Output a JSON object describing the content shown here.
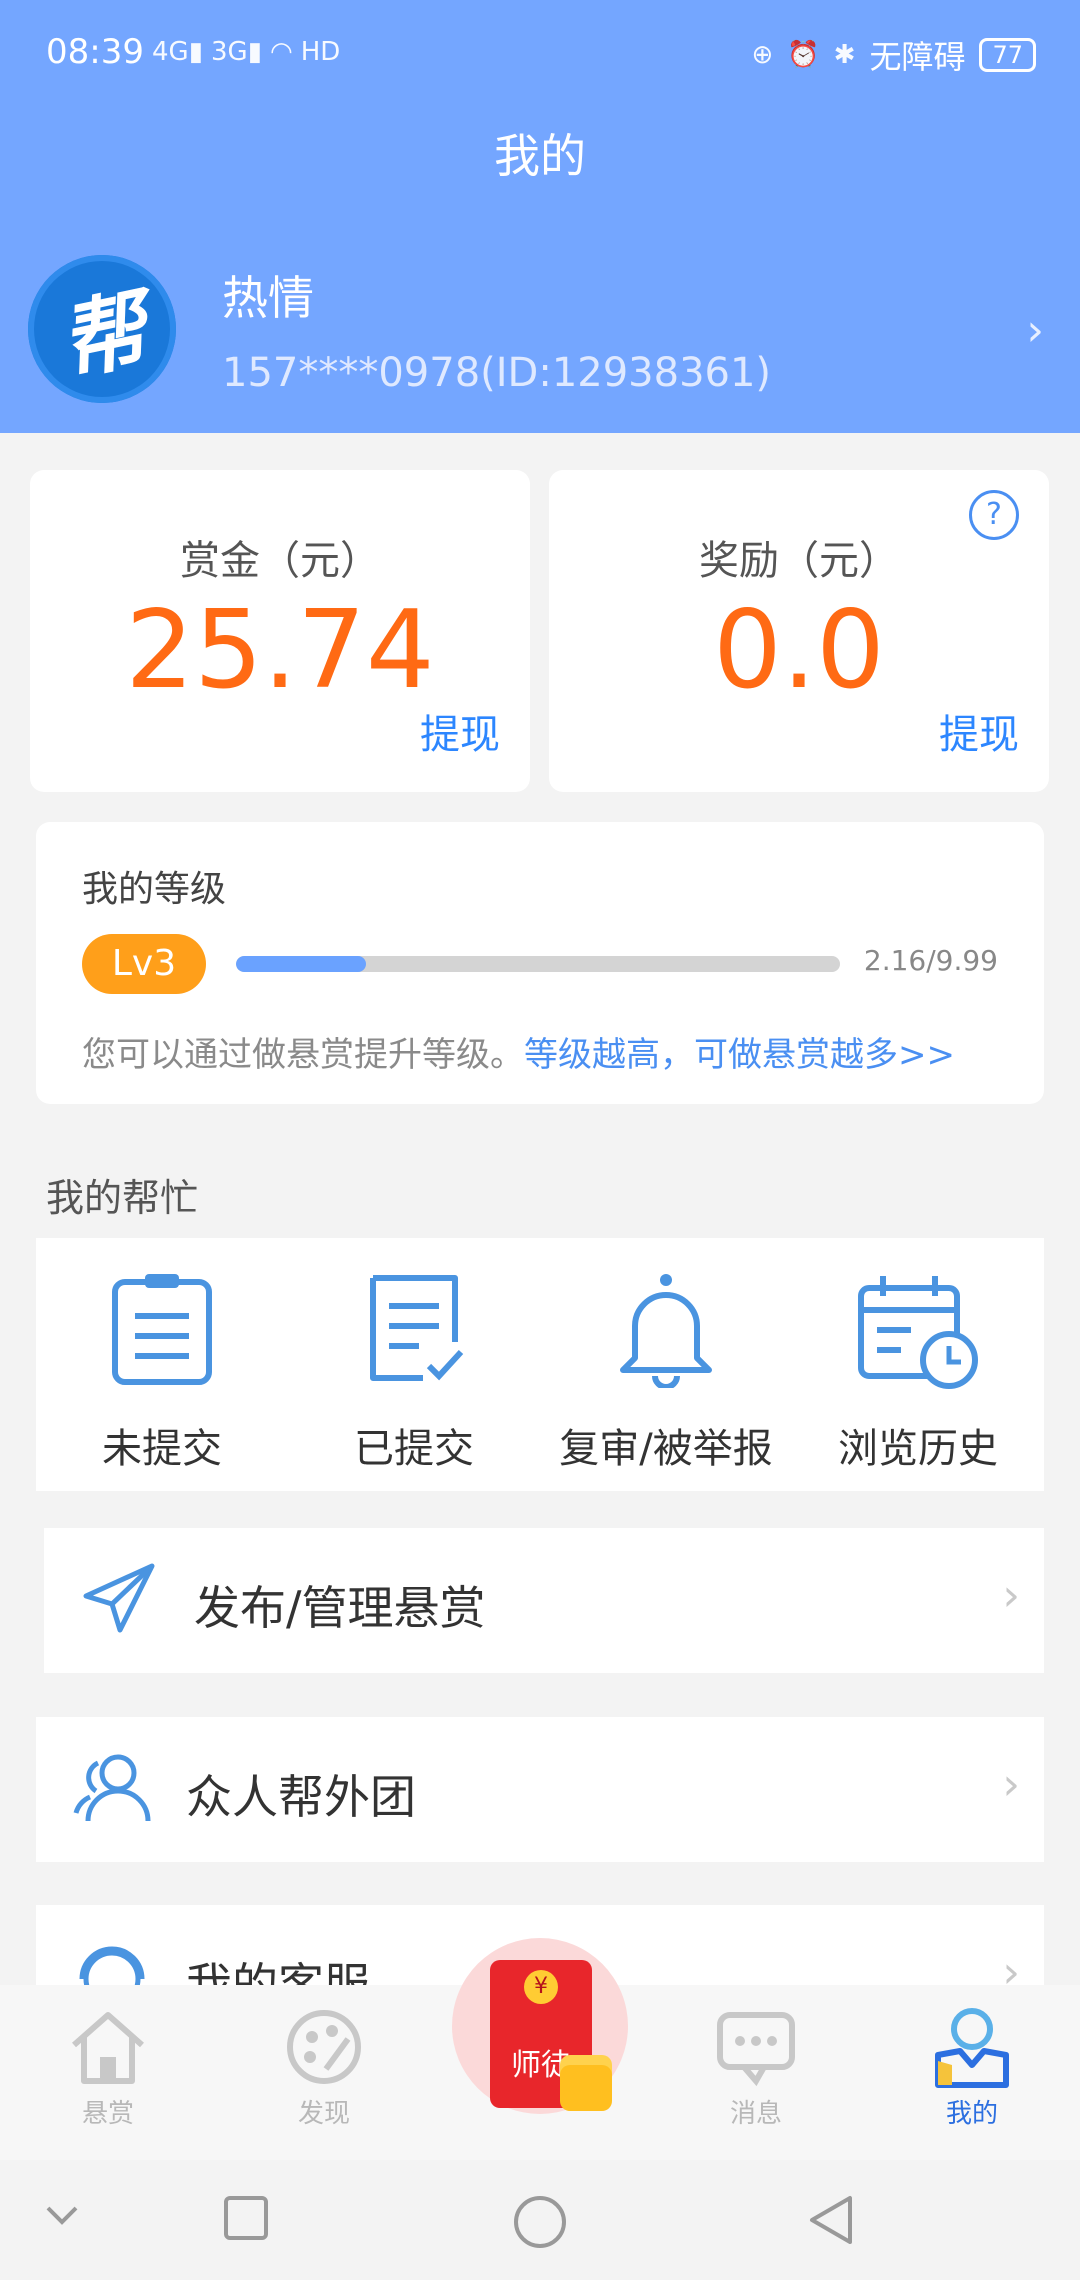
{
  "status_bar": {
    "time": "08:39",
    "net1": "4G",
    "net2": "3G",
    "hd": "HD",
    "accessibility": "无障碍",
    "battery": "77"
  },
  "header": {
    "title": "我的",
    "avatar_char": "帮",
    "nickname": "热情",
    "phone_id": "157****0978(ID:12938361)"
  },
  "wallet": {
    "bounty_label": "赏金（元）",
    "bounty_value": "25.74",
    "reward_label": "奖励（元）",
    "reward_value": "0.0",
    "withdraw": "提现",
    "help": "?"
  },
  "level": {
    "title": "我的等级",
    "badge": "Lv3",
    "progress_text": "2.16/9.99",
    "progress_fraction": 0.216,
    "desc": "您可以通过做悬赏提升等级。",
    "link": "等级越高，可做悬赏越多>>"
  },
  "my_help": {
    "title": "我的帮忙",
    "items": [
      {
        "label": "未提交",
        "icon": "clipboard-icon"
      },
      {
        "label": "已提交",
        "icon": "document-check-icon"
      },
      {
        "label": "复审/被举报",
        "icon": "bell-icon"
      },
      {
        "label": "浏览历史",
        "icon": "calendar-clock-icon"
      }
    ]
  },
  "menu": [
    {
      "label": "发布/管理悬赏",
      "icon": "paper-plane-icon"
    },
    {
      "label": "众人帮外团",
      "icon": "users-icon"
    },
    {
      "label": "我的客服",
      "icon": "customer-service-icon"
    }
  ],
  "bottom_nav": {
    "items": [
      {
        "label": "悬赏",
        "icon": "home-icon"
      },
      {
        "label": "发现",
        "icon": "palette-icon"
      },
      {
        "label": "消息",
        "icon": "chat-icon"
      },
      {
        "label": "我的",
        "icon": "profile-icon"
      }
    ],
    "center": {
      "label": "师徒",
      "coin": "¥",
      "icon": "red-envelope-icon"
    }
  },
  "colors": {
    "header": "#74a6ff",
    "amount": "#ff6a14",
    "link": "#2c86ff",
    "badge": "#ff9f1a",
    "active_tab": "#2c6fe0"
  }
}
